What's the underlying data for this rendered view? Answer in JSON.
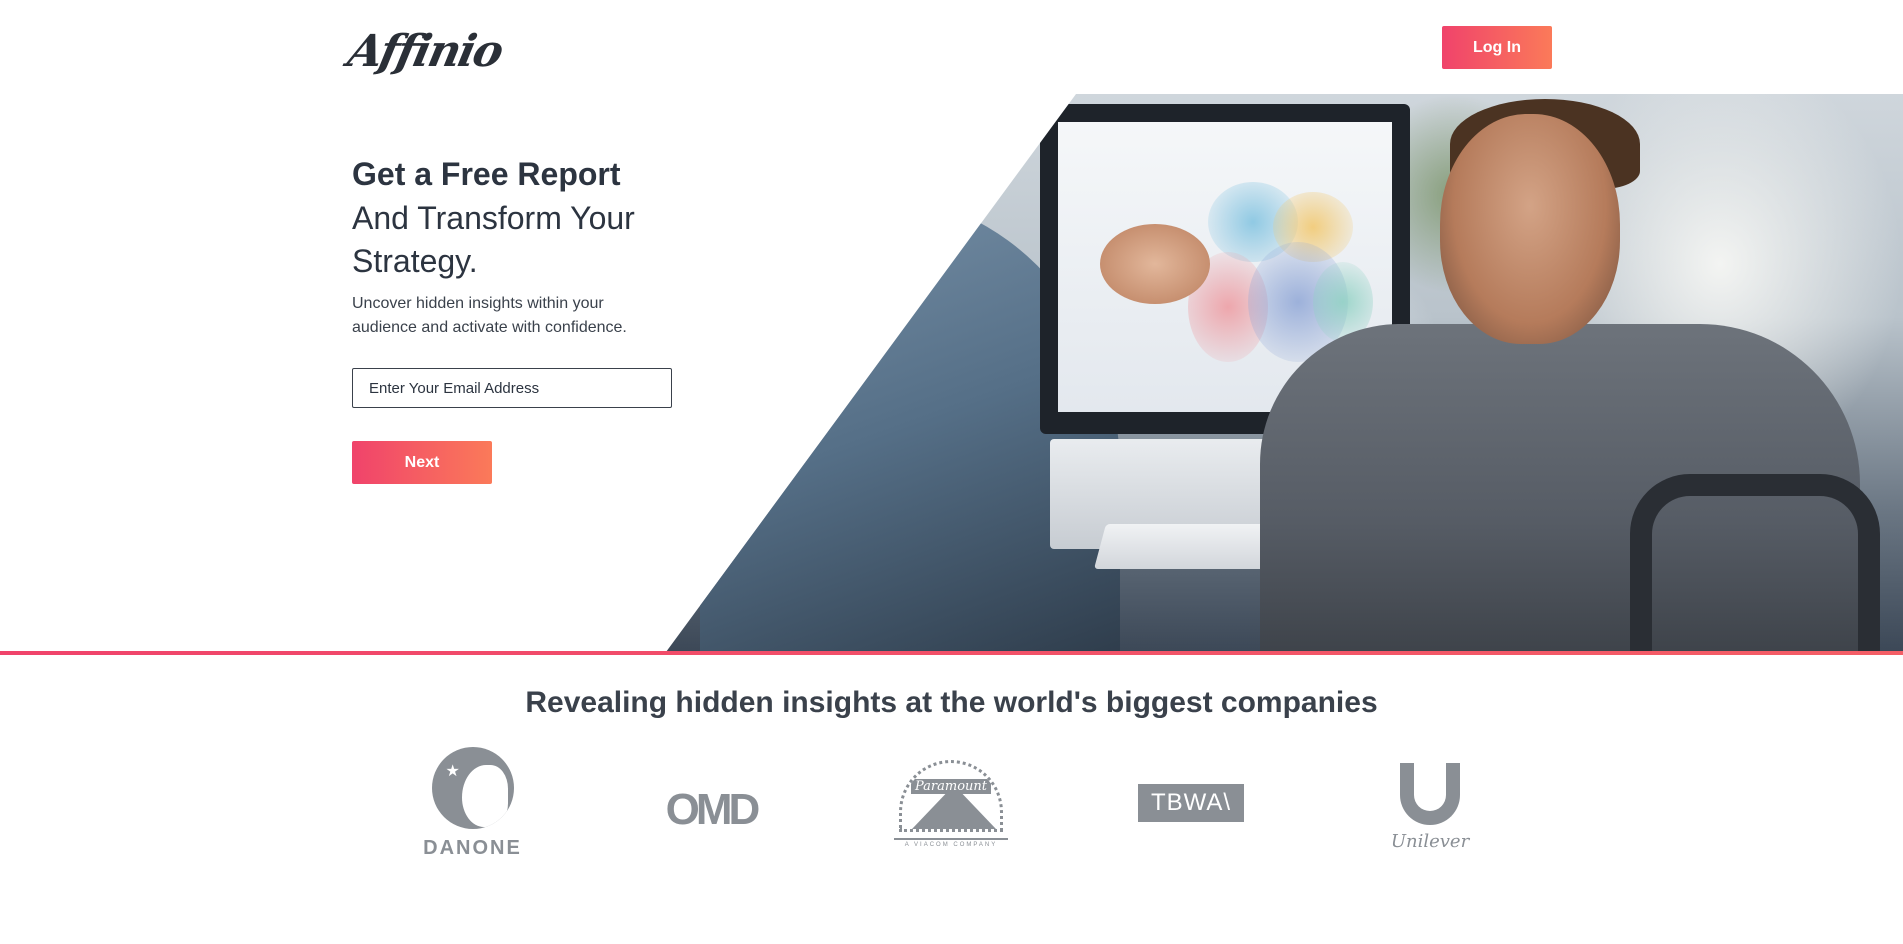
{
  "header": {
    "logo": "Affinio",
    "login_label": "Log In"
  },
  "hero": {
    "title": "Get a Free Report",
    "subtitle": "And Transform Your Strategy.",
    "description": "Uncover hidden insights within your audience and activate with confidence.",
    "email_placeholder": "Enter Your Email Address",
    "next_label": "Next"
  },
  "companies": {
    "heading": "Revealing hidden insights at the world's biggest companies",
    "logos": [
      {
        "name": "DANONE",
        "icon": "danone-logo"
      },
      {
        "name": "OMD",
        "icon": "omd-logo"
      },
      {
        "name": "Paramount",
        "sub": "A VIACOM COMPANY",
        "icon": "paramount-logo"
      },
      {
        "name": "TBWA\\",
        "icon": "tbwa-logo"
      },
      {
        "name": "Unilever",
        "icon": "unilever-logo"
      }
    ]
  },
  "colors": {
    "accent_start": "#f0436b",
    "accent_end": "#fb7a59",
    "text": "#2c3440",
    "logo_gray": "#8a8f95"
  }
}
